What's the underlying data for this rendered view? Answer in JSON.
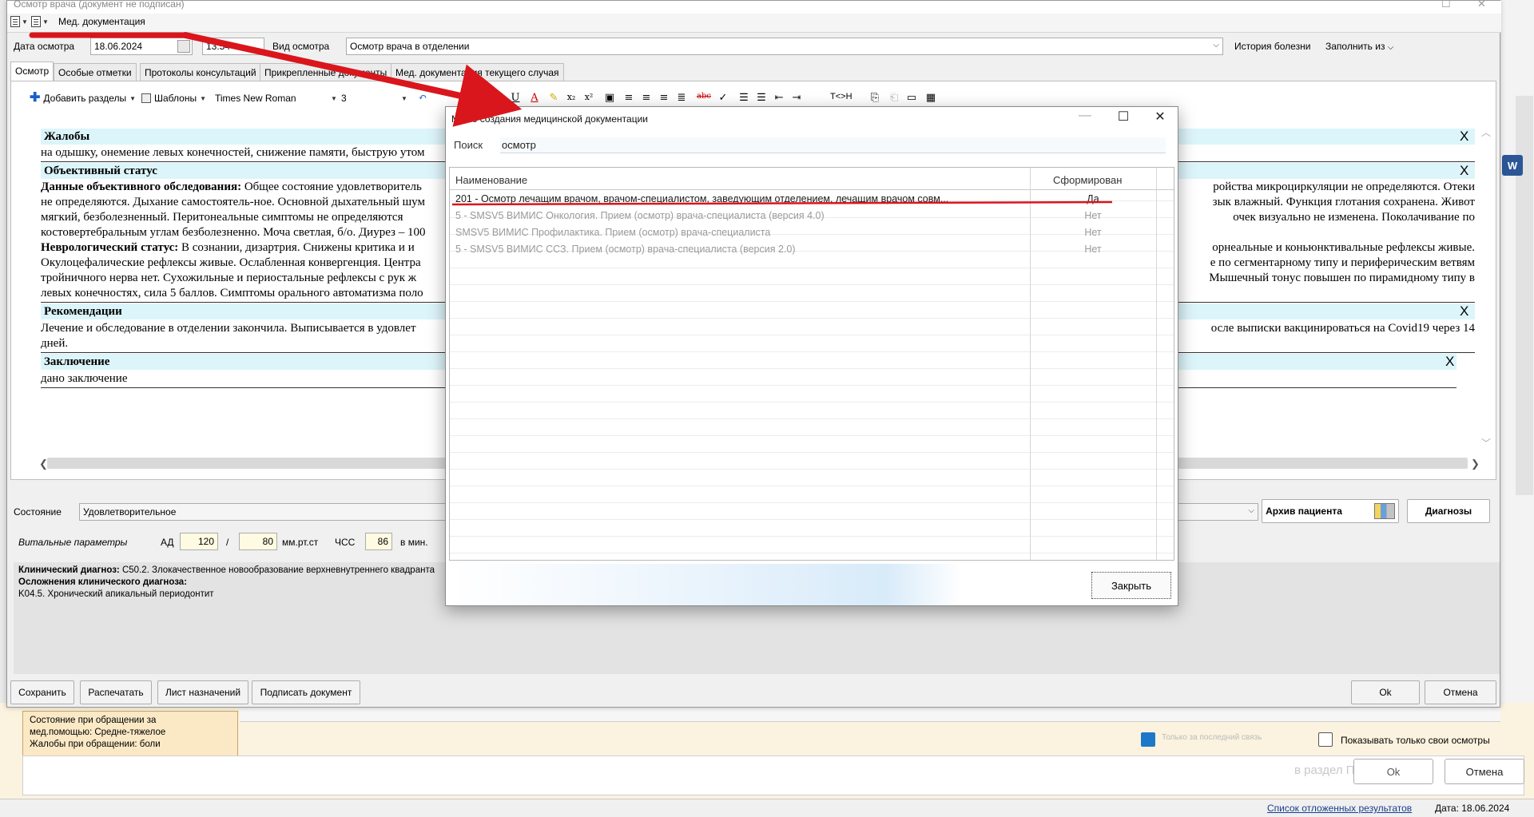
{
  "window": {
    "title": "Осмотр врача (документ не подписан)",
    "menu_med_doc": "Мед. документация"
  },
  "header": {
    "date_label": "Дата осмотра",
    "date_value": "18.06.2024",
    "time_value": "13:54",
    "exam_type_label": "Вид осмотра",
    "exam_type_value": "Осмотр врача в отделении",
    "history_button": "История болезни",
    "fill_from_button": "Заполнить из"
  },
  "tabs": [
    "Осмотр",
    "Особые отметки",
    "Протоколы консультаций",
    "Прикрепленные документы",
    "Мед. документация текущего случая"
  ],
  "toolbar": {
    "add_sections": "Добавить разделы",
    "templates": "Шаблоны",
    "font_name": "Times New Roman",
    "font_size": "3",
    "tag_label": "T<>H"
  },
  "document": {
    "sections": [
      {
        "title": "Жалобы",
        "left_lines": [
          "на одышку, онемение левых конечностей, снижение памяти, быструю утом"
        ],
        "right_lines": []
      },
      {
        "title": "Объективный статус",
        "left_lines": [
          "Данные объективного обследования: Общее состояние удовлетворитель",
          "не определяются. Дыхание самостоятель-ное. Основной дыхательный шум",
          "мягкий, безболезненный. Перитонеальные симптомы не определяются",
          "костовертебральным углам безболезненно. Моча светлая, б/о. Диурез – 100",
          "Неврологический статус: В сознании, дизартрия. Снижены критика и и",
          "Окулоцефалические рефлексы живые. Ослабленная конвергенция. Центра",
          "тройничного нерва нет. Сухожильные и периостальные рефлексы с рук ж",
          "левых конечностях, сила 5 баллов. Симптомы орального автоматизма поло"
        ],
        "right_lines": [
          "ройства микроциркуляции не определяются. Отеки",
          "зык влажный. Функция глотания сохранена. Живот",
          "очек визуально не изменена. Поколачивание по",
          "",
          "орнеальные и коньюнктивальные рефлексы живые.",
          "е по сегментарному типу и периферическим ветвям",
          "Мышечный тонус повышен по пирамидному типу в",
          ""
        ]
      },
      {
        "title": "Рекомендации",
        "left_lines": [
          "Лечение и обследование в отделении закончила. Выписывается в удовлет",
          "дней."
        ],
        "right_lines": [
          "осле выписки вакцинироваться на Covid19 через 14"
        ]
      },
      {
        "title": "Заключение",
        "left_lines": [
          "дано заключение"
        ],
        "right_lines": []
      }
    ],
    "close_mark": "X"
  },
  "state": {
    "label": "Состояние",
    "value": "Удовлетворительное",
    "archive_button": "Архив пациента",
    "diagnoses_button": "Диагнозы"
  },
  "vitals": {
    "label": "Витальные параметры",
    "ad_label": "АД",
    "systolic": "120",
    "slash": "/",
    "diastolic": "80",
    "ad_unit": "мм.рт.ст",
    "hr_label": "ЧСС",
    "hr_value": "86",
    "hr_unit": "в мин."
  },
  "diagnosis": {
    "clinical_label": "Клинический диагноз:",
    "clinical_value": " C50.2. Злокачественное новообразование верхневнутреннего квадранта",
    "complication_label": "Осложнения клинического диагноза:",
    "complication_value": "K04.5. Хронический апикальный периодонтит"
  },
  "bottom_buttons": {
    "save": "Сохранить",
    "print": "Распечатать",
    "prescriptions": "Лист назначений",
    "sign": "Подписать документ",
    "ok": "Ok",
    "cancel": "Отмена"
  },
  "modal": {
    "title": "Меню создания медицинской документации",
    "search_label": "Поиск",
    "search_value": "осмотр",
    "col_name": "Наименование",
    "col_formed": "Сформирован",
    "rows": [
      {
        "name": "201 - Осмотр лечащим врачом, врачом-специалистом, заведующим отделением, лечащим врачом совм...",
        "formed": "Да"
      },
      {
        "name": "5 - SMSV5 ВИМИС Онкология. Прием (осмотр) врача-специалиста (версия 4.0)",
        "formed": "Нет"
      },
      {
        "name": "SMSV5 ВИМИС Профилактика. Прием (осмотр) врача-специалиста",
        "formed": "Нет"
      },
      {
        "name": "5 - SMSV5 ВИМИС ССЗ. Прием (осмотр) врача-специалиста (версия 2.0)",
        "formed": "Нет"
      }
    ],
    "close_button": "Закрыть"
  },
  "background": {
    "left_card_lines": [
      "Состояние при обращении за",
      "мед.помощью: Средне-тяжелое",
      "Жалобы при обращении: боли"
    ],
    "only_last_label": "Только за последний связь",
    "show_own_label": "Показывать только свои осмотры",
    "ok_faded": "Ok",
    "cancel_faded": "Отмена",
    "section_text_faded": "в раздел Параметры",
    "status_link": "Список отложенных результатов",
    "status_date": "Дата: 18.06.2024"
  },
  "colors": {
    "section_header_bg": "#dcf5fb",
    "annotation_red": "#d9161c",
    "vital_input_bg": "#fffbe2"
  }
}
